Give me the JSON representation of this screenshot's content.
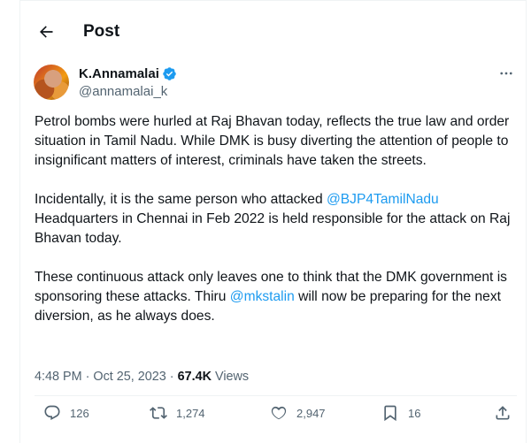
{
  "header": {
    "title": "Post"
  },
  "author": {
    "name": "K.Annamalai",
    "handle": "@annamalai_k"
  },
  "tweet": {
    "p1": "Petrol bombs were hurled at Raj Bhavan today, reflects the true law and order situation in Tamil Nadu. While DMK is busy diverting the attention of people to insignificant matters of interest, criminals have taken the streets.",
    "p2_before": "Incidentally, it is the same person who attacked ",
    "p2_mention": "@BJP4TamilNadu",
    "p2_after": " Headquarters in Chennai in Feb 2022 is held responsible for the attack on Raj Bhavan today.",
    "p3_before": "These continuous attack only leaves one to think that the DMK government is sponsoring these attacks. Thiru ",
    "p3_mention": "@mkstalin",
    "p3_after": " will now be preparing for the next diversion, as he always does."
  },
  "meta": {
    "time": "4:48 PM",
    "sep": "·",
    "date": "Oct 25, 2023",
    "views_count": "67.4K",
    "views_label": "Views"
  },
  "actions": {
    "replies": "126",
    "reposts": "1,274",
    "likes": "2,947",
    "bookmarks": "16"
  },
  "colors": {
    "accent": "#1d9bf0",
    "text": "#0f1419",
    "muted": "#536471"
  },
  "icons": [
    "back-arrow-icon",
    "verified-badge-icon",
    "more-icon",
    "reply-icon",
    "repost-icon",
    "like-icon",
    "bookmark-icon",
    "share-icon"
  ]
}
